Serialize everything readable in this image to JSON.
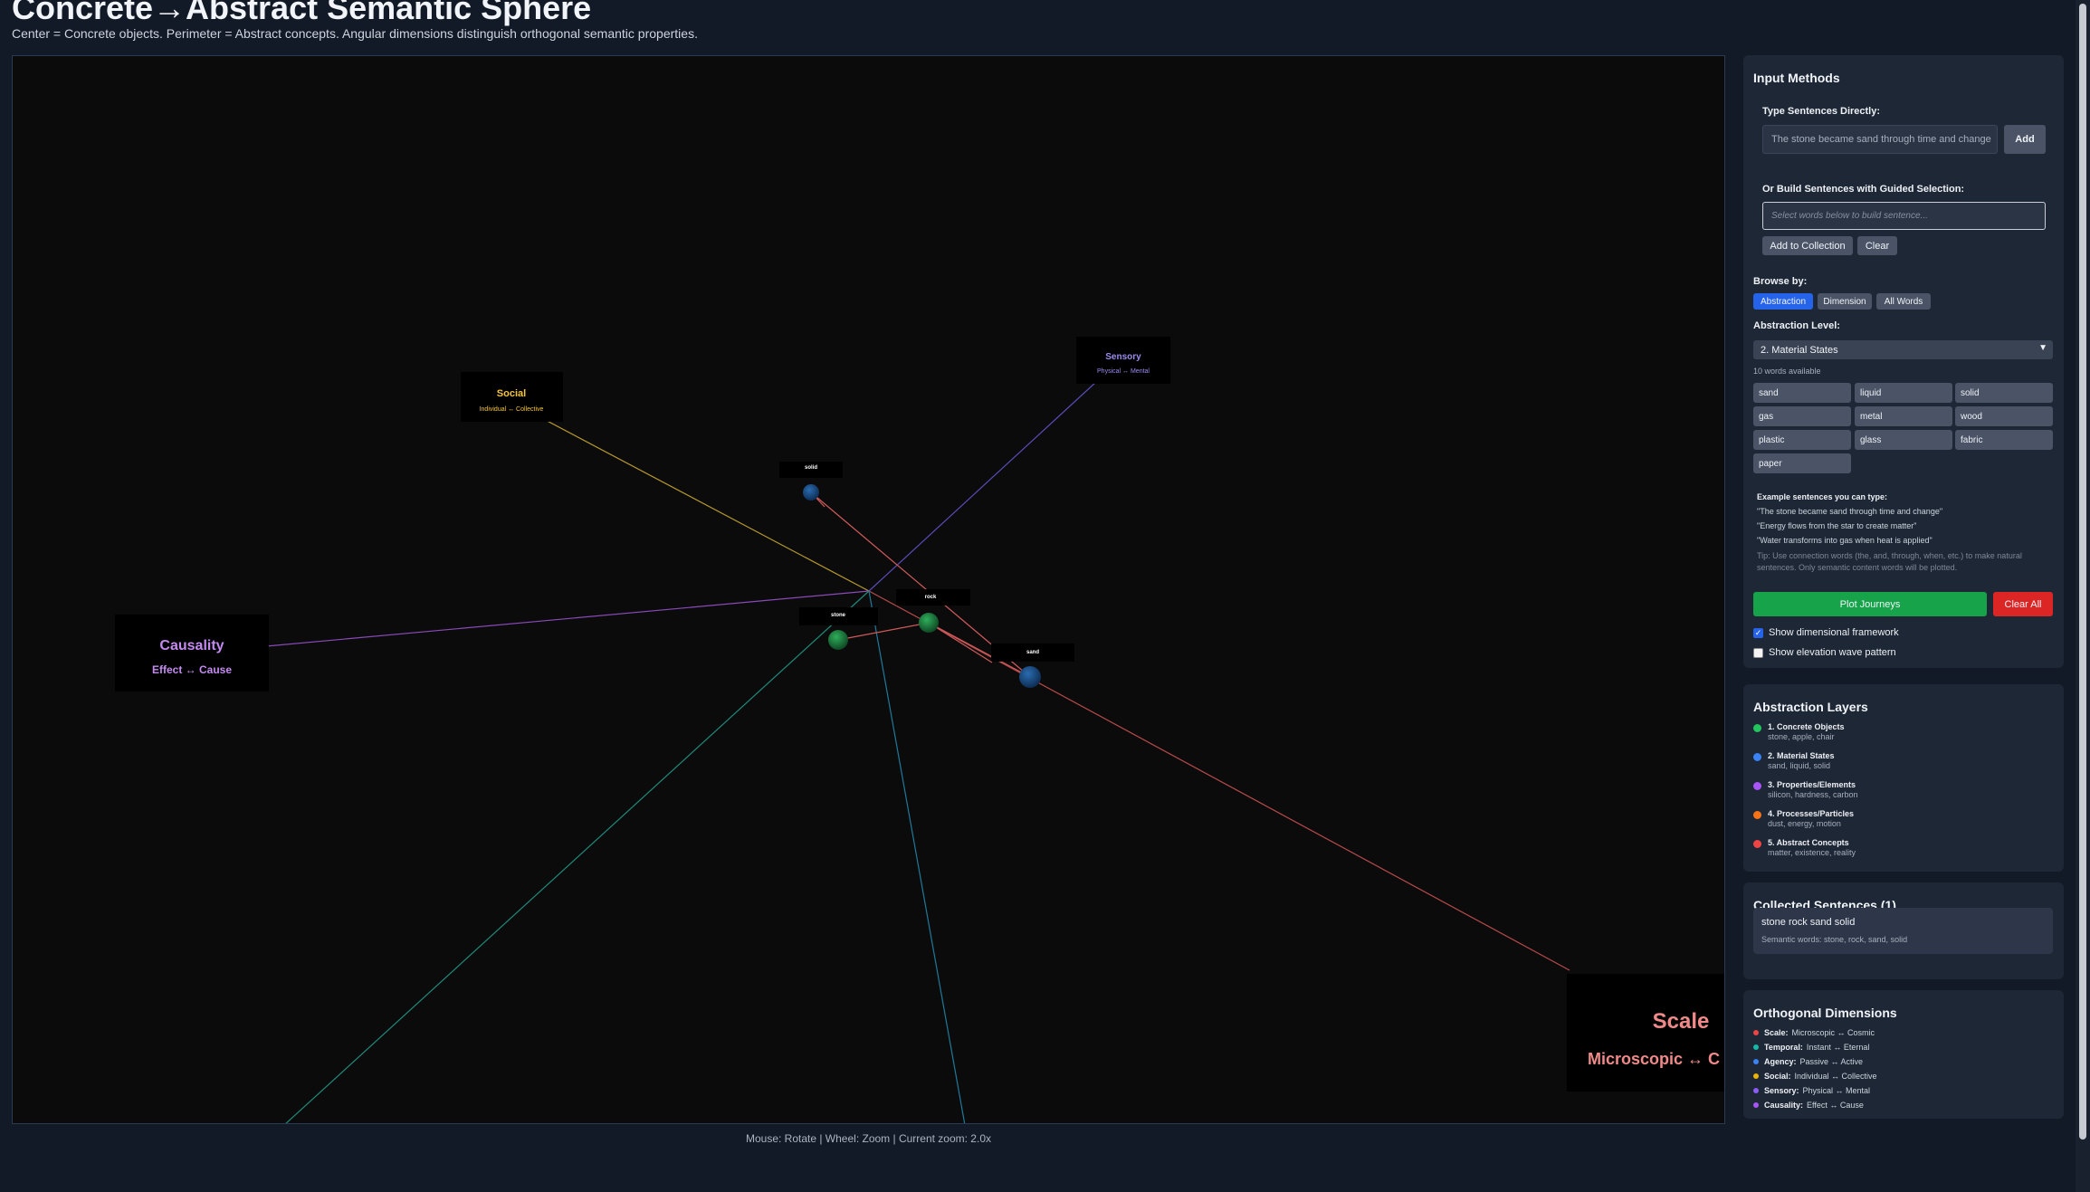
{
  "header": {
    "title": "Concrete→Abstract Semantic Sphere",
    "subtitle": "Center = Concrete objects. Perimeter = Abstract concepts. Angular dimensions distinguish orthogonal semantic properties."
  },
  "canvas": {
    "caption": "Mouse: Rotate | Wheel: Zoom | Current zoom: 2.0x",
    "dimension_labels": [
      {
        "name": "Scale",
        "range": "Microscopic ↔ C",
        "color": "#f08a8a"
      },
      {
        "name": "Sensory",
        "range": "Physical ↔ Mental",
        "color": "#9b8cf0"
      },
      {
        "name": "Social",
        "range": "Individual ↔ Collective",
        "color": "#f5c542"
      },
      {
        "name": "Causality",
        "range": "Effect ↔ Cause",
        "color": "#c58af0"
      }
    ],
    "word_points": [
      {
        "word": "solid",
        "color": "#1f5a96"
      },
      {
        "word": "rock",
        "color": "#1e8a45"
      },
      {
        "word": "stone",
        "color": "#1e8a45"
      },
      {
        "word": "sand",
        "color": "#1f5a96"
      }
    ]
  },
  "input_methods": {
    "title": "Input Methods",
    "type_label": "Type Sentences Directly:",
    "sentence_input_value": "The stone became sand through time and change",
    "add_label": "Add",
    "guided_label": "Or Build Sentences with Guided Selection:",
    "guided_placeholder": "Select words below to build sentence...",
    "add_to_collection_label": "Add to Collection",
    "clear_label": "Clear",
    "browse_by_label": "Browse by:",
    "browse_tabs": [
      "Abstraction",
      "Dimension",
      "All Words"
    ],
    "abstraction_level_label": "Abstraction Level:",
    "abstraction_level_value": "2. Material States",
    "words_available": "10 words available",
    "words": [
      "sand",
      "liquid",
      "solid",
      "gas",
      "metal",
      "wood",
      "plastic",
      "glass",
      "fabric",
      "paper"
    ],
    "examples_title": "Example sentences you can type:",
    "examples": [
      "\"The stone became sand through time and change\"",
      "\"Energy flows from the star to create matter\"",
      "\"Water transforms into gas when heat is applied\""
    ],
    "tip": "Tip: Use connection words (the, and, through, when, etc.) to make natural sentences. Only semantic content words will be plotted.",
    "plot_label": "Plot Journeys",
    "clear_all_label": "Clear All",
    "show_framework_label": "Show dimensional framework",
    "show_framework_checked": true,
    "show_wave_label": "Show elevation wave pattern",
    "show_wave_checked": false
  },
  "abstraction_layers": {
    "title": "Abstraction Layers",
    "layers": [
      {
        "name": "1. Concrete Objects",
        "examples": "stone, apple, chair",
        "color": "#22c55e"
      },
      {
        "name": "2. Material States",
        "examples": "sand, liquid, solid",
        "color": "#3b82f6"
      },
      {
        "name": "3. Properties/Elements",
        "examples": "silicon, hardness, carbon",
        "color": "#a855f7"
      },
      {
        "name": "4. Processes/Particles",
        "examples": "dust, energy, motion",
        "color": "#f97316"
      },
      {
        "name": "5. Abstract Concepts",
        "examples": "matter, existence, reality",
        "color": "#ef4444"
      }
    ]
  },
  "collected": {
    "title": "Collected Sentences (1)",
    "items": [
      {
        "text": "stone rock sand solid",
        "semantic": "Semantic words: stone, rock, sand, solid"
      }
    ]
  },
  "orthogonal_dimensions": {
    "title": "Orthogonal Dimensions",
    "dimensions": [
      {
        "name": "Scale:",
        "range": "Microscopic ↔ Cosmic",
        "color": "#ef4444"
      },
      {
        "name": "Temporal:",
        "range": "Instant ↔ Eternal",
        "color": "#14b8a6"
      },
      {
        "name": "Agency:",
        "range": "Passive ↔ Active",
        "color": "#3b82f6"
      },
      {
        "name": "Social:",
        "range": "Individual ↔ Collective",
        "color": "#eab308"
      },
      {
        "name": "Sensory:",
        "range": "Physical ↔ Mental",
        "color": "#8b5cf6"
      },
      {
        "name": "Causality:",
        "range": "Effect ↔ Cause",
        "color": "#a855f7"
      }
    ]
  }
}
